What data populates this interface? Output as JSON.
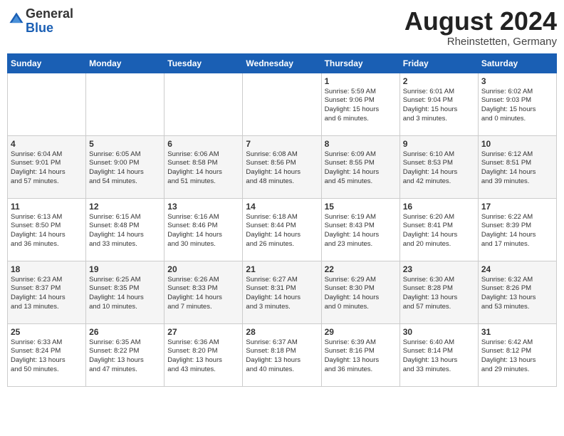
{
  "header": {
    "logo_general": "General",
    "logo_blue": "Blue",
    "title": "August 2024",
    "subtitle": "Rheinstetten, Germany"
  },
  "calendar": {
    "weekdays": [
      "Sunday",
      "Monday",
      "Tuesday",
      "Wednesday",
      "Thursday",
      "Friday",
      "Saturday"
    ],
    "weeks": [
      [
        {
          "day": "",
          "info": ""
        },
        {
          "day": "",
          "info": ""
        },
        {
          "day": "",
          "info": ""
        },
        {
          "day": "",
          "info": ""
        },
        {
          "day": "1",
          "info": "Sunrise: 5:59 AM\nSunset: 9:06 PM\nDaylight: 15 hours\nand 6 minutes."
        },
        {
          "day": "2",
          "info": "Sunrise: 6:01 AM\nSunset: 9:04 PM\nDaylight: 15 hours\nand 3 minutes."
        },
        {
          "day": "3",
          "info": "Sunrise: 6:02 AM\nSunset: 9:03 PM\nDaylight: 15 hours\nand 0 minutes."
        }
      ],
      [
        {
          "day": "4",
          "info": "Sunrise: 6:04 AM\nSunset: 9:01 PM\nDaylight: 14 hours\nand 57 minutes."
        },
        {
          "day": "5",
          "info": "Sunrise: 6:05 AM\nSunset: 9:00 PM\nDaylight: 14 hours\nand 54 minutes."
        },
        {
          "day": "6",
          "info": "Sunrise: 6:06 AM\nSunset: 8:58 PM\nDaylight: 14 hours\nand 51 minutes."
        },
        {
          "day": "7",
          "info": "Sunrise: 6:08 AM\nSunset: 8:56 PM\nDaylight: 14 hours\nand 48 minutes."
        },
        {
          "day": "8",
          "info": "Sunrise: 6:09 AM\nSunset: 8:55 PM\nDaylight: 14 hours\nand 45 minutes."
        },
        {
          "day": "9",
          "info": "Sunrise: 6:10 AM\nSunset: 8:53 PM\nDaylight: 14 hours\nand 42 minutes."
        },
        {
          "day": "10",
          "info": "Sunrise: 6:12 AM\nSunset: 8:51 PM\nDaylight: 14 hours\nand 39 minutes."
        }
      ],
      [
        {
          "day": "11",
          "info": "Sunrise: 6:13 AM\nSunset: 8:50 PM\nDaylight: 14 hours\nand 36 minutes."
        },
        {
          "day": "12",
          "info": "Sunrise: 6:15 AM\nSunset: 8:48 PM\nDaylight: 14 hours\nand 33 minutes."
        },
        {
          "day": "13",
          "info": "Sunrise: 6:16 AM\nSunset: 8:46 PM\nDaylight: 14 hours\nand 30 minutes."
        },
        {
          "day": "14",
          "info": "Sunrise: 6:18 AM\nSunset: 8:44 PM\nDaylight: 14 hours\nand 26 minutes."
        },
        {
          "day": "15",
          "info": "Sunrise: 6:19 AM\nSunset: 8:43 PM\nDaylight: 14 hours\nand 23 minutes."
        },
        {
          "day": "16",
          "info": "Sunrise: 6:20 AM\nSunset: 8:41 PM\nDaylight: 14 hours\nand 20 minutes."
        },
        {
          "day": "17",
          "info": "Sunrise: 6:22 AM\nSunset: 8:39 PM\nDaylight: 14 hours\nand 17 minutes."
        }
      ],
      [
        {
          "day": "18",
          "info": "Sunrise: 6:23 AM\nSunset: 8:37 PM\nDaylight: 14 hours\nand 13 minutes."
        },
        {
          "day": "19",
          "info": "Sunrise: 6:25 AM\nSunset: 8:35 PM\nDaylight: 14 hours\nand 10 minutes."
        },
        {
          "day": "20",
          "info": "Sunrise: 6:26 AM\nSunset: 8:33 PM\nDaylight: 14 hours\nand 7 minutes."
        },
        {
          "day": "21",
          "info": "Sunrise: 6:27 AM\nSunset: 8:31 PM\nDaylight: 14 hours\nand 3 minutes."
        },
        {
          "day": "22",
          "info": "Sunrise: 6:29 AM\nSunset: 8:30 PM\nDaylight: 14 hours\nand 0 minutes."
        },
        {
          "day": "23",
          "info": "Sunrise: 6:30 AM\nSunset: 8:28 PM\nDaylight: 13 hours\nand 57 minutes."
        },
        {
          "day": "24",
          "info": "Sunrise: 6:32 AM\nSunset: 8:26 PM\nDaylight: 13 hours\nand 53 minutes."
        }
      ],
      [
        {
          "day": "25",
          "info": "Sunrise: 6:33 AM\nSunset: 8:24 PM\nDaylight: 13 hours\nand 50 minutes."
        },
        {
          "day": "26",
          "info": "Sunrise: 6:35 AM\nSunset: 8:22 PM\nDaylight: 13 hours\nand 47 minutes."
        },
        {
          "day": "27",
          "info": "Sunrise: 6:36 AM\nSunset: 8:20 PM\nDaylight: 13 hours\nand 43 minutes."
        },
        {
          "day": "28",
          "info": "Sunrise: 6:37 AM\nSunset: 8:18 PM\nDaylight: 13 hours\nand 40 minutes."
        },
        {
          "day": "29",
          "info": "Sunrise: 6:39 AM\nSunset: 8:16 PM\nDaylight: 13 hours\nand 36 minutes."
        },
        {
          "day": "30",
          "info": "Sunrise: 6:40 AM\nSunset: 8:14 PM\nDaylight: 13 hours\nand 33 minutes."
        },
        {
          "day": "31",
          "info": "Sunrise: 6:42 AM\nSunset: 8:12 PM\nDaylight: 13 hours\nand 29 minutes."
        }
      ]
    ]
  }
}
